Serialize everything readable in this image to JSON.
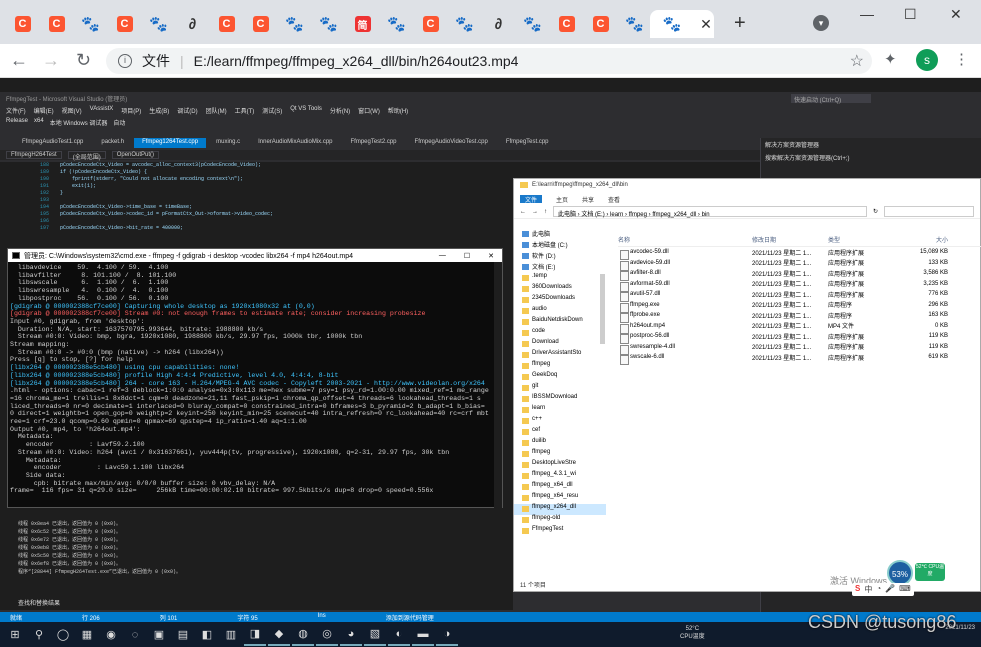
{
  "browser": {
    "tabs": [
      {
        "icon": "csdn-icon",
        "glyph": "C",
        "cls": "c"
      },
      {
        "icon": "csdn-icon",
        "glyph": "C",
        "cls": "c"
      },
      {
        "icon": "baidu-paw-icon",
        "glyph": "🐾",
        "cls": "p"
      },
      {
        "icon": "csdn-icon",
        "glyph": "C",
        "cls": "c"
      },
      {
        "icon": "baidu-paw-icon",
        "glyph": "🐾",
        "cls": "p"
      },
      {
        "icon": "script-a-icon",
        "glyph": "∂",
        "cls": "a"
      },
      {
        "icon": "csdn-icon",
        "glyph": "C",
        "cls": "c"
      },
      {
        "icon": "csdn-icon",
        "glyph": "C",
        "cls": "c"
      },
      {
        "icon": "baidu-paw-icon",
        "glyph": "🐾",
        "cls": "p"
      },
      {
        "icon": "baidu-paw-icon",
        "glyph": "🐾",
        "cls": "p"
      },
      {
        "icon": "jianshu-icon",
        "glyph": "简",
        "cls": "j"
      },
      {
        "icon": "baidu-paw-icon",
        "glyph": "🐾",
        "cls": "p"
      },
      {
        "icon": "csdn-icon",
        "glyph": "C",
        "cls": "c"
      },
      {
        "icon": "baidu-paw-icon",
        "glyph": "🐾",
        "cls": "p"
      },
      {
        "icon": "script-a-icon",
        "glyph": "∂",
        "cls": "a"
      },
      {
        "icon": "baidu-paw-icon",
        "glyph": "🐾",
        "cls": "p"
      },
      {
        "icon": "csdn-icon",
        "glyph": "C",
        "cls": "c"
      },
      {
        "icon": "csdn-icon",
        "glyph": "C",
        "cls": "c"
      },
      {
        "icon": "baidu-paw-icon",
        "glyph": "🐾",
        "cls": "p"
      },
      {
        "icon": "baidu-paw-icon",
        "glyph": "🐾",
        "cls": "p"
      }
    ],
    "tab_close": "✕",
    "new_tab": "+",
    "url_prefix": "文件",
    "url": "E:/learn/ffmpeg/ffmpeg_x264_dll/bin/h264out23.mp4",
    "avatar_letter": "s",
    "bookmark_icon": "☆",
    "extensions_icon": "✦",
    "menu_icon": "⋮"
  },
  "vs": {
    "title": "FfmpegTest - Microsoft Visual Studio (管理员)",
    "search": "快速启动 (Ctrl+Q)",
    "menus": [
      "文件(F)",
      "编辑(E)",
      "视图(V)",
      "VAssistX",
      "项目(P)",
      "生成(B)",
      "调试(D)",
      "团队(M)",
      "工具(T)",
      "测试(S)",
      "Qt VS Tools",
      "分析(N)",
      "窗口(W)",
      "帮助(H)"
    ],
    "toolbar": [
      "Release",
      "x64",
      "本地 Windows 调试器",
      "自动"
    ],
    "doc_tabs": [
      "FfmpegAudioTest1.cpp",
      "packet.h",
      "Ffmpeg1264Test.cpp",
      "muxing.c",
      "InnerAudioMixAudioMix.cpp",
      "FfmpegTest2.cpp",
      "FfmpegAudioVideoTest.cpp",
      "FfmpegTest.cpp"
    ],
    "active_tab_index": 2,
    "nav": [
      "FfmpegH264Test",
      "(全局范围)",
      "OpenOutPut()"
    ],
    "code": [
      {
        "n": "188",
        "t": "pCodecEncodeCtx_Video = avcodec_alloc_context3(pCodecEncode_Video);"
      },
      {
        "n": "189",
        "t": "if (!pCodecEncodeCtx_Video) {"
      },
      {
        "n": "190",
        "t": "    fprintf(stderr, \"Could not allocate encoding context\\n\");"
      },
      {
        "n": "191",
        "t": "    exit(1);"
      },
      {
        "n": "192",
        "t": "}"
      },
      {
        "n": "193",
        "t": ""
      },
      {
        "n": "194",
        "t": "pCodecEncodeCtx_Video->time_base = timeBase;"
      },
      {
        "n": "195",
        "t": "pCodecEncodeCtx_Video->codec_id = pFormatCtx_Out->oformat->video_codec;"
      },
      {
        "n": "196",
        "t": ""
      },
      {
        "n": "197",
        "t": "pCodecEncodeCtx_Video->bit_rate = 400000;"
      }
    ],
    "solution_title": "解决方案资源管理器",
    "solution_search": "搜索解决方案资源管理器(Ctrl+;)",
    "output": [
      "线程 0x8ea4 已退出，返回值为 0 (0x0)。",
      "线程 0x6c52 已退出，返回值为 0 (0x0)。",
      "线程 0x6e72 已退出，返回值为 0 (0x0)。",
      "线程 0x9eb8 已退出，返回值为 0 (0x0)。",
      "线程 0x5c50 已退出，返回值为 0 (0x0)。",
      "线程 0x6ef8 已退出，返回值为 0 (0x0)。",
      "程序“[28844] FfmpegH264Test.exe”已退出，返回值为 0 (0x0)。"
    ],
    "output_tab": "查找和替换结果",
    "status": [
      "就绪",
      "行 206",
      "列 101",
      "字符 95",
      "Ins",
      "添加到源代码管理"
    ]
  },
  "cmd": {
    "title": "管理员: C:\\Windows\\system32\\cmd.exe - ffmpeg  -f gdigrab -i desktop  -vcodec libx264 -f mp4 h264out.mp4",
    "lines": [
      {
        "c": "",
        "t": "  libavdevice    59.  4.100 / 59.  4.100"
      },
      {
        "c": "",
        "t": "  libavfilter     8. 101.100 /  8. 101.100"
      },
      {
        "c": "",
        "t": "  libswscale      6.  1.100 /  6.  1.100"
      },
      {
        "c": "",
        "t": "  libswresample   4.  0.100 /  4.  0.100"
      },
      {
        "c": "",
        "t": "  libpostproc    56.  0.100 / 56.  0.100"
      },
      {
        "c": "cy",
        "t": "[gdigrab @ 000002388cf7ce00] Capturing whole desktop as 1920x1080x32 at (0,0)"
      },
      {
        "c": "rd",
        "t": "[gdigrab @ 000002388cf7ce00] Stream #0: not enough frames to estimate rate; consider increasing probesize"
      },
      {
        "c": "",
        "t": "Input #0, gdigrab, from 'desktop':"
      },
      {
        "c": "",
        "t": "  Duration: N/A, start: 1637570795.993644, bitrate: 1988800 kb/s"
      },
      {
        "c": "",
        "t": "  Stream #0:0: Video: bmp, bgra, 1920x1080, 1988800 kb/s, 29.97 fps, 1000k tbr, 1000k tbn"
      },
      {
        "c": "",
        "t": "Stream mapping:"
      },
      {
        "c": "",
        "t": "  Stream #0:0 -> #0:0 (bmp (native) -> h264 (libx264))"
      },
      {
        "c": "",
        "t": "Press [q] to stop, [?] for help"
      },
      {
        "c": "cy",
        "t": "[libx264 @ 000002388e5cb480] using cpu capabilities: none!"
      },
      {
        "c": "cy",
        "t": "[libx264 @ 000002388e5cb480] profile High 4:4:4 Predictive, level 4.0, 4:4:4, 8-bit"
      },
      {
        "c": "cy",
        "t": "[libx264 @ 000002388e5cb480] 264 - core 163 - H.264/MPEG-4 AVC codec - Copyleft 2003-2021 - http://www.videolan.org/x264"
      },
      {
        "c": "",
        "t": ".html - options: cabac=1 ref=3 deblock=1:0:0 analyse=0x3:0x113 me=hex subme=7 psy=1 psy_rd=1.00:0.00 mixed_ref=1 me_range"
      },
      {
        "c": "",
        "t": "=16 chroma_me=1 trellis=1 8x8dct=1 cqm=0 deadzone=21,11 fast_pskip=1 chroma_qp_offset=4 threads=6 lookahead_threads=1 s"
      },
      {
        "c": "",
        "t": "liced_threads=0 nr=0 decimate=1 interlaced=0 bluray_compat=0 constrained_intra=0 bframes=3 b_pyramid=2 b_adapt=1 b_bias="
      },
      {
        "c": "",
        "t": "0 direct=1 weightb=1 open_gop=0 weightp=2 keyint=250 keyint_min=25 scenecut=40 intra_refresh=0 rc_lookahead=40 rc=crf mbt"
      },
      {
        "c": "",
        "t": "ree=1 crf=23.0 qcomp=0.60 qpmin=0 qpmax=69 qpstep=4 ip_ratio=1.40 aq=1:1.00"
      },
      {
        "c": "",
        "t": "Output #0, mp4, to 'h264out.mp4':"
      },
      {
        "c": "",
        "t": "  Metadata:"
      },
      {
        "c": "",
        "t": "    encoder         : Lavf59.2.100"
      },
      {
        "c": "",
        "t": "  Stream #0:0: Video: h264 (avc1 / 0x31637661), yuv444p(tv, progressive), 1920x1080, q=2-31, 29.97 fps, 30k tbn"
      },
      {
        "c": "",
        "t": "    Metadata:"
      },
      {
        "c": "",
        "t": "      encoder         : Lavc59.1.100 libx264"
      },
      {
        "c": "",
        "t": "    Side data:"
      },
      {
        "c": "",
        "t": "      cpb: bitrate max/min/avg: 0/0/0 buffer size: 0 vbv_delay: N/A"
      },
      {
        "c": "",
        "t": "frame=  116 fps= 31 q=29.0 size=     256kB time=00:00:02.10 bitrate= 997.5kbits/s dup=8 drop=0 speed=0.556x"
      }
    ]
  },
  "explorer": {
    "title": "E:\\learn\\ffmpeg\\ffmpeg_x264_dll\\bin",
    "ribbon": [
      "文件",
      "主页",
      "共享",
      "查看"
    ],
    "breadcrumb": [
      "此电脑",
      "文档 (E:)",
      "learn",
      "ffmpeg",
      "ffmpeg_x264_dll",
      "bin"
    ],
    "nav": [
      {
        "t": "此电脑",
        "cls": "lib"
      },
      {
        "t": "本地磁盘 (C:)",
        "cls": "lib"
      },
      {
        "t": "软件 (D:)",
        "cls": "lib"
      },
      {
        "t": "文档 (E:)",
        "cls": "lib"
      },
      {
        "t": ".temp",
        "cls": ""
      },
      {
        "t": "360Downloads",
        "cls": ""
      },
      {
        "t": "2345Downloads",
        "cls": ""
      },
      {
        "t": "audio",
        "cls": ""
      },
      {
        "t": "BaiduNetdiskDown",
        "cls": ""
      },
      {
        "t": "code",
        "cls": ""
      },
      {
        "t": "Download",
        "cls": ""
      },
      {
        "t": "DriverAssistantSto",
        "cls": ""
      },
      {
        "t": "ffmpeg",
        "cls": ""
      },
      {
        "t": "GeekDoq",
        "cls": ""
      },
      {
        "t": "git",
        "cls": ""
      },
      {
        "t": "IBSSMDownload",
        "cls": ""
      },
      {
        "t": "learn",
        "cls": ""
      },
      {
        "t": "c++",
        "cls": ""
      },
      {
        "t": "cef",
        "cls": ""
      },
      {
        "t": "duilib",
        "cls": ""
      },
      {
        "t": "ffmpeg",
        "cls": ""
      },
      {
        "t": "DesktopLiveStre",
        "cls": ""
      },
      {
        "t": "ffmpeg_4.3.1_wi",
        "cls": ""
      },
      {
        "t": "ffmpeg_x64_dll",
        "cls": ""
      },
      {
        "t": "ffmpeg_x64_resu",
        "cls": ""
      },
      {
        "t": "ffmpeg_x264_dll",
        "cls": "sel"
      },
      {
        "t": "ffmpeg-old",
        "cls": ""
      },
      {
        "t": "FfmpegTest",
        "cls": ""
      }
    ],
    "headers": [
      "名称",
      "修改日期",
      "类型",
      "大小"
    ],
    "files": [
      {
        "name": "avcodec-59.dll",
        "date": "2021/11/23 星期二 1...",
        "type": "应用程序扩展",
        "size": "15,089 KB"
      },
      {
        "name": "avdevice-59.dll",
        "date": "2021/11/23 星期二 1...",
        "type": "应用程序扩展",
        "size": "133 KB"
      },
      {
        "name": "avfilter-8.dll",
        "date": "2021/11/23 星期二 1...",
        "type": "应用程序扩展",
        "size": "3,586 KB"
      },
      {
        "name": "avformat-59.dll",
        "date": "2021/11/23 星期二 1...",
        "type": "应用程序扩展",
        "size": "3,235 KB"
      },
      {
        "name": "avutil-57.dll",
        "date": "2021/11/23 星期二 1...",
        "type": "应用程序扩展",
        "size": "776 KB"
      },
      {
        "name": "ffmpeg.exe",
        "date": "2021/11/23 星期二 1...",
        "type": "应用程序",
        "size": "296 KB"
      },
      {
        "name": "ffprobe.exe",
        "date": "2021/11/23 星期二 1...",
        "type": "应用程序",
        "size": "163 KB"
      },
      {
        "name": "h264out.mp4",
        "date": "2021/11/23 星期二 1...",
        "type": "MP4 文件",
        "size": "0 KB"
      },
      {
        "name": "postproc-56.dll",
        "date": "2021/11/23 星期二 1...",
        "type": "应用程序扩展",
        "size": "119 KB"
      },
      {
        "name": "swresample-4.dll",
        "date": "2021/11/23 星期二 1...",
        "type": "应用程序扩展",
        "size": "119 KB"
      },
      {
        "name": "swscale-6.dll",
        "date": "2021/11/23 星期二 1...",
        "type": "应用程序扩展",
        "size": "619 KB"
      }
    ],
    "status": "11 个项目"
  },
  "overlay": {
    "watermark": "激活 Windows",
    "csdn": "CSDN @tusong86",
    "speed_pct": "53%",
    "cpu_temp": "52℃ CPU温度"
  },
  "taskbar": {
    "icons": [
      {
        "name": "start-icon",
        "g": "⊞"
      },
      {
        "name": "search-icon",
        "g": "⚲"
      },
      {
        "name": "task-view-icon",
        "g": "◯"
      },
      {
        "name": "taskview-grid-icon",
        "g": "▦"
      },
      {
        "name": "app-icon",
        "g": "◉"
      },
      {
        "name": "app-icon",
        "g": "◌"
      },
      {
        "name": "app-icon",
        "g": "▣"
      },
      {
        "name": "app-icon",
        "g": "▤"
      },
      {
        "name": "app-icon",
        "g": "◧"
      },
      {
        "name": "app-icon",
        "g": "▥"
      },
      {
        "name": "app-icon",
        "g": "◨"
      },
      {
        "name": "visual-studio-icon",
        "g": "◆"
      },
      {
        "name": "wechat-icon",
        "g": "◍"
      },
      {
        "name": "app-icon",
        "g": "◎"
      },
      {
        "name": "chrome-icon",
        "g": "◕"
      },
      {
        "name": "app-icon",
        "g": "▧"
      },
      {
        "name": "app-icon",
        "g": "◐"
      },
      {
        "name": "cmd-icon",
        "g": "▬"
      },
      {
        "name": "app-icon",
        "g": "◑"
      }
    ],
    "temp": "52°C",
    "temp_label": "CPU温度",
    "time": "",
    "date": "2021/11/23"
  }
}
